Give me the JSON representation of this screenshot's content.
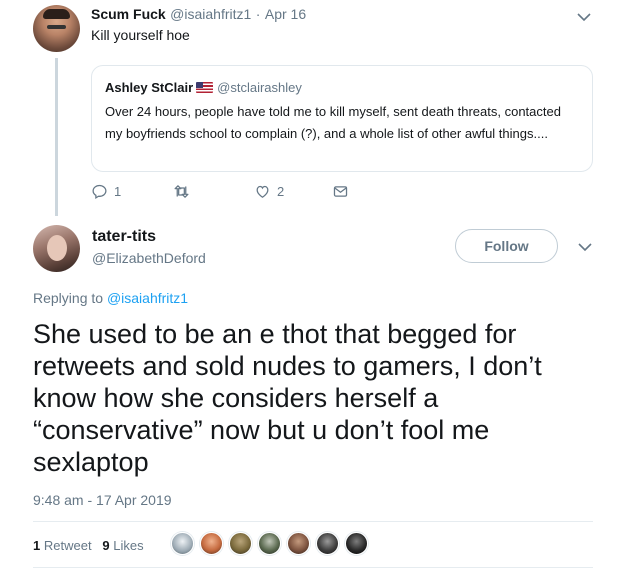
{
  "parent_tweet": {
    "name": "Scum Fuck",
    "handle": "@isaiahfritz1",
    "separator": "·",
    "date": "Apr 16",
    "text": "Kill yourself hoe",
    "quoted": {
      "name": "Ashley StClair",
      "flag_icon": "us-flag-icon",
      "handle": "@stclairashley",
      "text": "Over 24 hours, people have told me to kill myself, sent death threats, contacted my boyfriends school to complain (?), and a whole list of other awful things...."
    },
    "actions": {
      "reply_count": "1",
      "retweet_count": "",
      "like_count": "2"
    }
  },
  "main_tweet": {
    "name": "tater-tits",
    "handle": "@ElizabethDeford",
    "follow_label": "Follow",
    "replying_prefix": "Replying to",
    "replying_handle": "@isaiahfritz1",
    "text": "She used to be an e thot that begged for retweets and sold nudes to gamers, I don’t know how she considers herself a “conservative” now but u don’t fool me sexlaptop",
    "timestamp": "9:48 am - 17 Apr 2019",
    "retweets_count": "1",
    "retweets_label": "Retweet",
    "likes_count": "9",
    "likes_label": "Likes",
    "liker_avatar_count": 7
  },
  "colors": {
    "text": "#14171a",
    "secondary": "#657786",
    "link": "#1da1f2",
    "border": "#e1e8ed"
  }
}
